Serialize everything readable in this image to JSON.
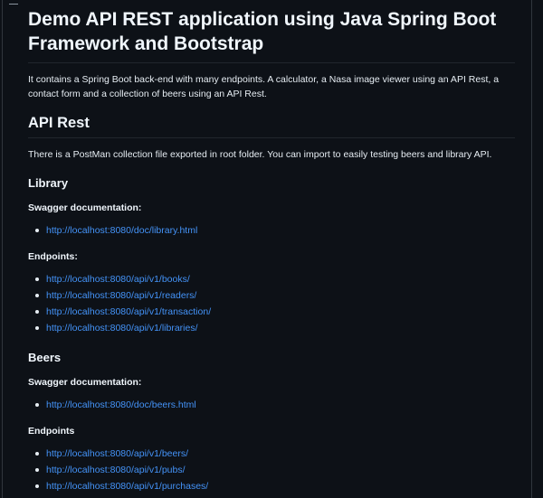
{
  "title": "Demo API REST application using Java Spring Boot Framework and Bootstrap",
  "intro": "It contains a Spring Boot back-end with many endpoints. A calculator, a Nasa image viewer using an API Rest, a contact form and a collection of beers using an API Rest.",
  "api_rest": {
    "heading": "API Rest",
    "text": "There is a PostMan collection file exported in root folder. You can import to easily testing beers and library API."
  },
  "library": {
    "heading": "Library",
    "swagger_heading": "Swagger documentation:",
    "swagger_links": [
      "http://localhost:8080/doc/library.html"
    ],
    "endpoints_heading": "Endpoints:",
    "endpoints": [
      "http://localhost:8080/api/v1/books/",
      "http://localhost:8080/api/v1/readers/",
      "http://localhost:8080/api/v1/transaction/",
      "http://localhost:8080/api/v1/libraries/"
    ]
  },
  "beers": {
    "heading": "Beers",
    "swagger_heading": "Swagger documentation:",
    "swagger_links": [
      "http://localhost:8080/doc/beers.html"
    ],
    "endpoints_heading": "Endpoints",
    "endpoints": [
      "http://localhost:8080/api/v1/beers/",
      "http://localhost:8080/api/v1/pubs/",
      "http://localhost:8080/api/v1/purchases/"
    ]
  },
  "colors": {
    "background": "#0d1117",
    "text": "#e6edf3",
    "link": "#4493f8",
    "divider": "#21262d"
  }
}
